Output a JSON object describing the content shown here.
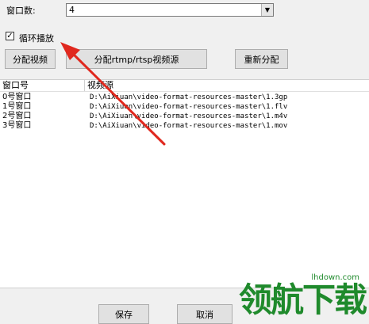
{
  "form": {
    "window_count_label": "窗口数:",
    "window_count_value": "4",
    "loop_checkbox_label": "循环播放",
    "loop_checked": true
  },
  "buttons": {
    "assign_video": "分配视频",
    "assign_rtmp": "分配rtmp/rtsp视频源",
    "reassign": "重新分配",
    "save": "保存",
    "cancel": "取消"
  },
  "table": {
    "columns": [
      "窗口号",
      "视频源"
    ],
    "rows": [
      {
        "window": "0号窗口",
        "source": "D:\\AiXiuan\\video-format-resources-master\\1.3gp"
      },
      {
        "window": "1号窗口",
        "source": "D:\\AiXiuan\\video-format-resources-master\\1.flv"
      },
      {
        "window": "2号窗口",
        "source": "D:\\AiXiuan\\video-format-resources-master\\1.m4v"
      },
      {
        "window": "3号窗口",
        "source": "D:\\AiXiuan\\video-format-resources-master\\1.mov"
      }
    ]
  },
  "watermark": {
    "site": "lhdown.com",
    "brand": "领航下载"
  },
  "colors": {
    "annotation_arrow": "#e0281e",
    "watermark_text": "#1f8a2c",
    "button_face": "#e1e1e1",
    "window_bg": "#f0f0f0"
  }
}
